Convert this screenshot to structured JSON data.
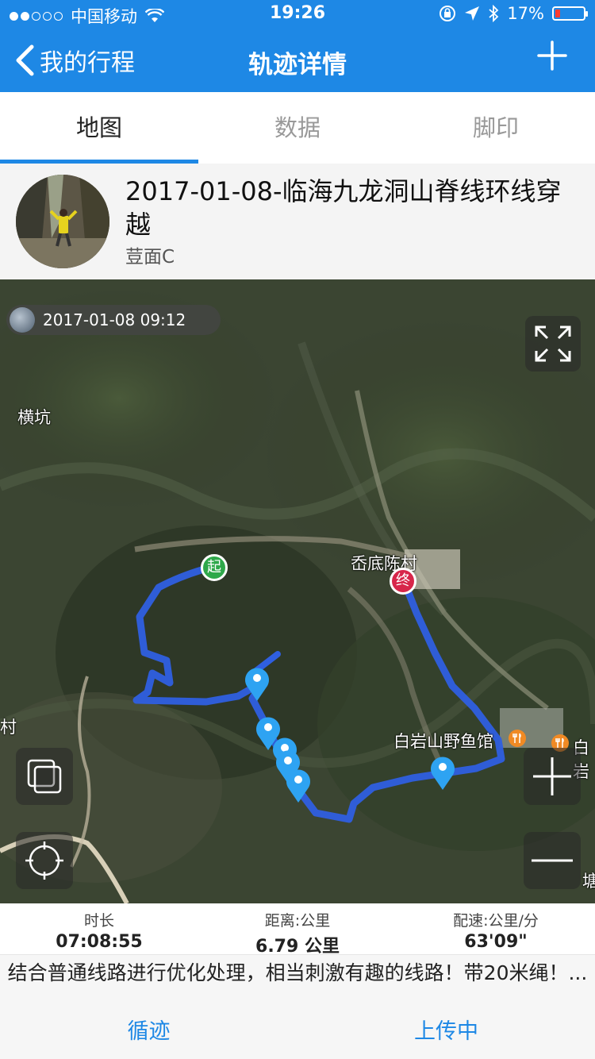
{
  "status": {
    "carrier": "中国移动",
    "time": "19:26",
    "battery": "17%",
    "battery_level": 0.17
  },
  "nav": {
    "back_label": "我的行程",
    "title": "轨迹详情",
    "add_icon": "plus-icon"
  },
  "tabs": [
    {
      "label": "地图",
      "active": true
    },
    {
      "label": "数据",
      "active": false
    },
    {
      "label": "脚印",
      "active": false
    }
  ],
  "track": {
    "title": "2017-01-08-临海九龙洞山脊线环线穿越",
    "author": "荳面C"
  },
  "map": {
    "time_label": "2017-01-08 09:12",
    "start_marker": "起",
    "end_marker": "终",
    "places": {
      "hengkeng": "横坑",
      "village_right": "岙底陈村",
      "restaurant": "白岩山野鱼馆",
      "restaurant_cut": "白岩",
      "left_cut": "村",
      "right_cut": "塘"
    },
    "route_color": "#2f5fe0",
    "pin_color": "#2ea3f2"
  },
  "stats": [
    {
      "label": "时长",
      "value": "07:08:55"
    },
    {
      "label": "距离:公里",
      "value": "6.79 公里"
    },
    {
      "label": "配速:公里/分",
      "value": "63'09\""
    }
  ],
  "description": "结合普通线路进行优化处理，相当刺激有趣的线路！带20米绳！...",
  "actions": {
    "follow": "循迹",
    "upload": "上传中"
  }
}
